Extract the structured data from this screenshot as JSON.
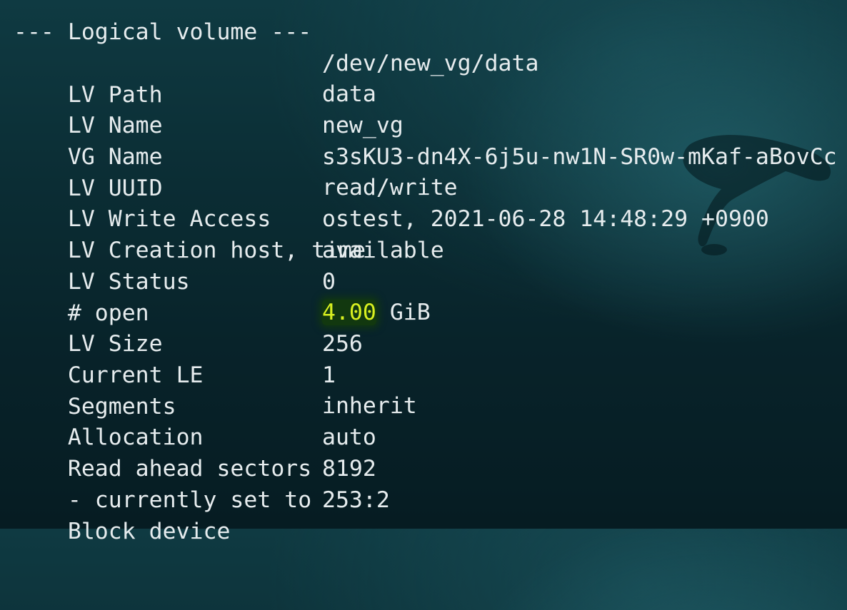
{
  "terminal": {
    "header": "--- Logical volume ---",
    "rows": [
      {
        "key": "LV Path",
        "value": "/dev/new_vg/data"
      },
      {
        "key": "LV Name",
        "value": "data"
      },
      {
        "key": "VG Name",
        "value": "new_vg"
      },
      {
        "key": "LV UUID",
        "value": "s3sKU3-dn4X-6j5u-nw1N-SR0w-mKaf-aBovCc"
      },
      {
        "key": "LV Write Access",
        "value": "read/write"
      },
      {
        "key": "LV Creation host, time",
        "value": "ostest, 2021-06-28 14:48:29 +0900"
      },
      {
        "key": "LV Status",
        "value": "available"
      },
      {
        "key": "# open",
        "value": "0"
      },
      {
        "key": "LV Size",
        "value_highlight": "4.00",
        "value_rest": " GiB"
      },
      {
        "key": "Current LE",
        "value": "256"
      },
      {
        "key": "Segments",
        "value": "1"
      },
      {
        "key": "Allocation",
        "value": "inherit"
      },
      {
        "key": "Read ahead sectors",
        "value": "auto"
      },
      {
        "key": "- currently set to",
        "value": "8192"
      },
      {
        "key": "Block device",
        "value": "253:2"
      }
    ]
  },
  "colors": {
    "background": "#0b2d34",
    "text": "#e6ecee",
    "highlight_text": "#d8f020",
    "highlight_bg": "#143c0a"
  }
}
